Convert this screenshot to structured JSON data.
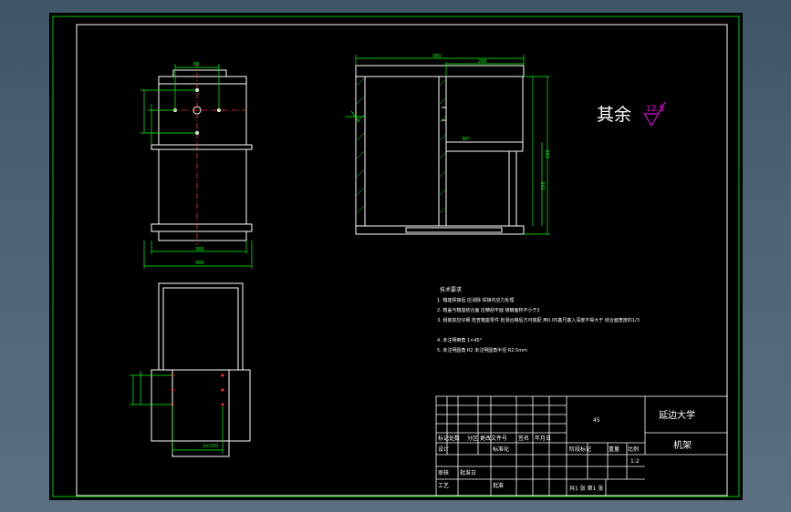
{
  "colors": {
    "background": "#000000",
    "frame": "#00c800",
    "geometry": "#ffffff",
    "dimension": "#00ff00",
    "center": "#ff3030",
    "hatch": "#00ff00",
    "roughness_mark": "#ff00ff"
  },
  "roughness": {
    "label": "其余",
    "value": "12.5"
  },
  "dimensions": {
    "top_left_width": "80",
    "front_width": "380",
    "front_inner_width": "296",
    "front_height_a": "335",
    "front_height_b": "180",
    "left_width_a": "300",
    "left_width_b": "300",
    "bottom_hole_spacing": "2×150",
    "angle": "30°"
  },
  "notes": {
    "title": "技术要求",
    "lines": [
      "1. 箱座焊接后 应消除 焊接内应力处理",
      "2. 箱盖与箱座结合面 应精刮平面 接触面积不小于2",
      "3. 组装前应仔细 检查箱座零件 检测合格后方可装配 用0.05塞尺塞入深度不得大于 结合面宽度的1/3",
      "4. 未注明倒角 1×45°",
      "5. 未注明圆角 R2 未注明圆角半径 R2.5mm"
    ]
  },
  "title_block": {
    "university": "延边大学",
    "part_name": "机架",
    "material_code": "45",
    "scale": "1:2",
    "sheet_info": "共1 张   第1 张",
    "row_labels": [
      "标记",
      "处数",
      "分区",
      "更改文件号",
      "签名",
      "年月日"
    ],
    "design_row": [
      "设计",
      "标准化"
    ],
    "review_row": [
      "审核",
      "批准日"
    ],
    "process_row": [
      "工艺",
      "批准"
    ],
    "stage_headers": [
      "阶段标记",
      "重量",
      "比例"
    ]
  }
}
